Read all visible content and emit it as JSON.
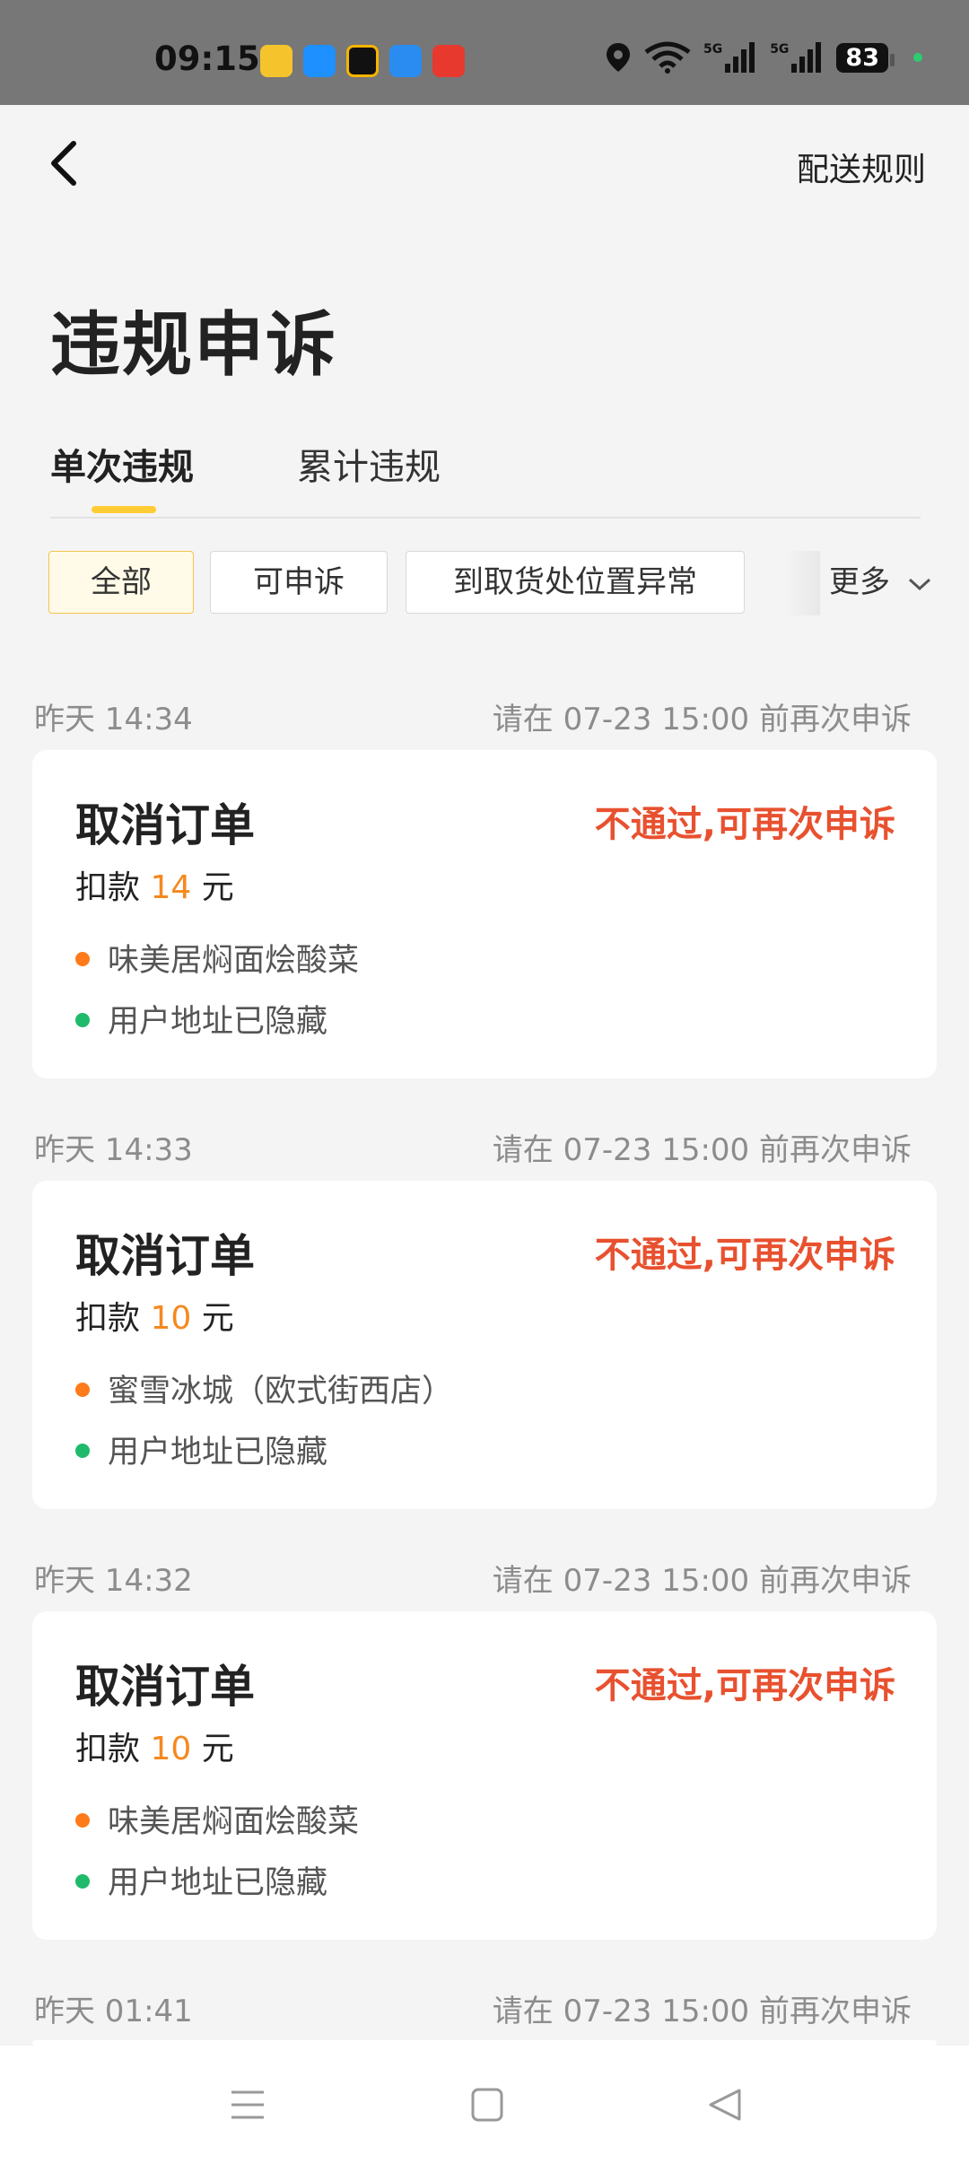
{
  "status_bar": {
    "time": "09:15",
    "signal_1": "5G",
    "signal_2": "5G",
    "battery": "83",
    "icons": [
      "location-icon",
      "wifi-icon",
      "signal-icon",
      "battery-icon"
    ]
  },
  "header": {
    "back_icon": "chevron-left-icon",
    "rules_link": "配送规则",
    "title": "违规申诉"
  },
  "tabs": [
    {
      "label": "单次违规",
      "active": true
    },
    {
      "label": "累计违规",
      "active": false
    }
  ],
  "filters": {
    "chips": [
      {
        "label": "全部",
        "active": true
      },
      {
        "label": "可申诉",
        "active": false
      },
      {
        "label": "到取货处位置异常",
        "active": false
      }
    ],
    "more_label": "更多"
  },
  "records": [
    {
      "time": "昨天 14:34",
      "deadline": "请在 07-23 15:00 前再次申诉",
      "type": "取消订单",
      "status": "不通过,可再次申诉",
      "fine_prefix": "扣款",
      "fine_amount": "14",
      "fine_unit": "元",
      "shop": "味美居焖面烩酸菜",
      "address": "用户地址已隐藏"
    },
    {
      "time": "昨天 14:33",
      "deadline": "请在 07-23 15:00 前再次申诉",
      "type": "取消订单",
      "status": "不通过,可再次申诉",
      "fine_prefix": "扣款",
      "fine_amount": "10",
      "fine_unit": "元",
      "shop": "蜜雪冰城（欧式街西店）",
      "address": "用户地址已隐藏"
    },
    {
      "time": "昨天 14:32",
      "deadline": "请在 07-23 15:00 前再次申诉",
      "type": "取消订单",
      "status": "不通过,可再次申诉",
      "fine_prefix": "扣款",
      "fine_amount": "10",
      "fine_unit": "元",
      "shop": "味美居焖面烩酸菜",
      "address": "用户地址已隐藏"
    },
    {
      "time": "昨天 01:41",
      "deadline": "请在 07-23 15:00 前再次申诉"
    }
  ],
  "colors": {
    "accent_yellow": "#ffcc33",
    "status_red": "#e8512f",
    "amount_orange": "#f5891f",
    "shop_dot": "#ff7a1a",
    "address_dot": "#1fba6b"
  },
  "bottom_nav": [
    "menu-icon",
    "home-icon",
    "back-icon"
  ]
}
